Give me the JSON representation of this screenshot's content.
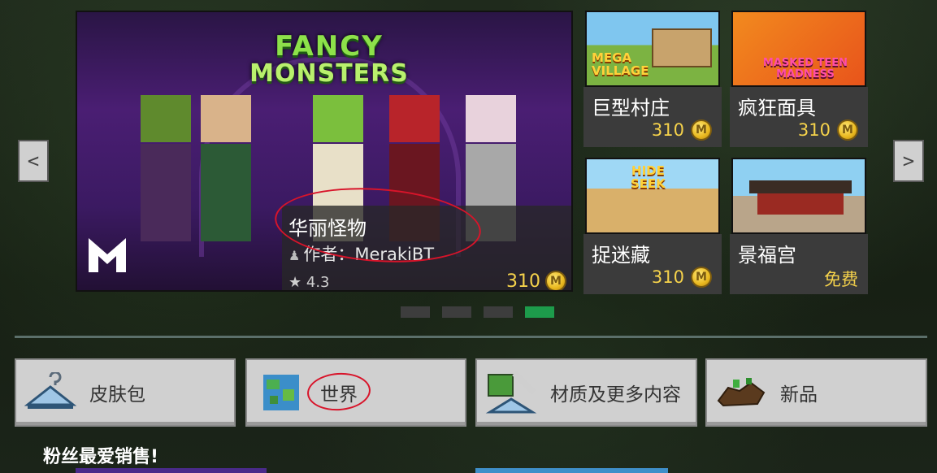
{
  "hero": {
    "title": "华丽怪物",
    "author": "作者：MerakiBT",
    "rating": "4.3",
    "price": "310",
    "logo_line1": "FANCY",
    "logo_line2": "MONSTERS"
  },
  "tiles": [
    {
      "name": "巨型村庄",
      "price": "310",
      "art_label_1": "MEGA",
      "art_label_2": "VILLAGE"
    },
    {
      "name": "疯狂面具",
      "price": "310",
      "art_label_1": "MASKED TEEN",
      "art_label_2": "MADNESS"
    },
    {
      "name": "捉迷藏",
      "price": "310",
      "art_label_1": "HIDE",
      "art_label_2": "SEEK"
    },
    {
      "name": "景福宫",
      "price": "免费"
    }
  ],
  "coin_glyph": "M",
  "carousel": {
    "count": 4,
    "active_index": 3
  },
  "categories": [
    {
      "label": "皮肤包",
      "icon": "hanger-icon"
    },
    {
      "label": "世界",
      "icon": "globe-icon"
    },
    {
      "label": "材质及更多内容",
      "icon": "texture-pack-icon"
    },
    {
      "label": "新品",
      "icon": "new-items-icon"
    }
  ],
  "section_title": "粉丝最爱销售!",
  "nav": {
    "prev": "<",
    "next": ">"
  },
  "colors": {
    "price": "#f5d24b",
    "carousel_active": "#1d9b4b",
    "annotation": "#d8142a"
  }
}
